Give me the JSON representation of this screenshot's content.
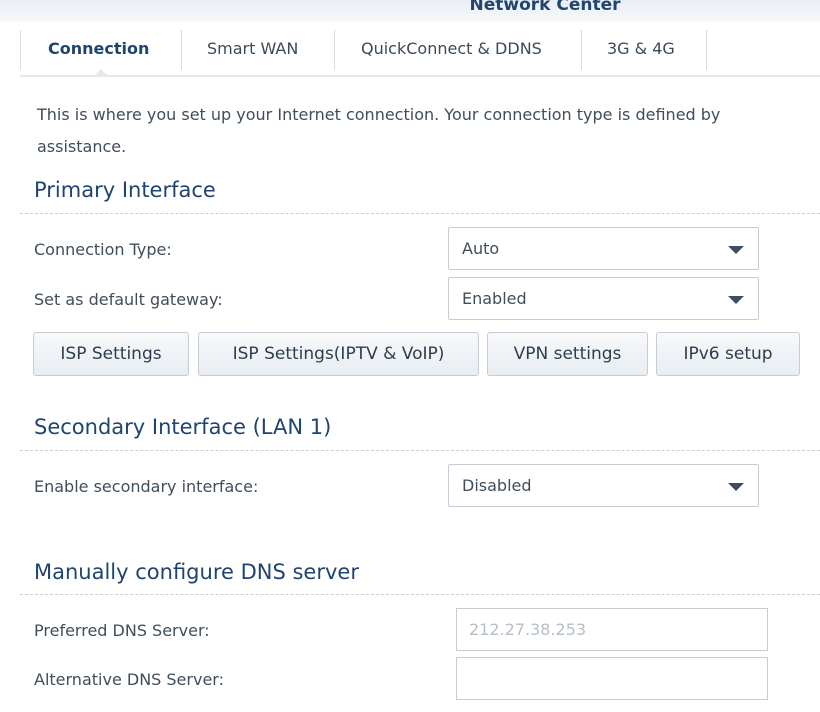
{
  "window": {
    "title": "Network Center"
  },
  "tabs": [
    {
      "label": "Connection",
      "active": true
    },
    {
      "label": "Smart WAN",
      "active": false
    },
    {
      "label": "QuickConnect & DDNS",
      "active": false
    },
    {
      "label": "3G & 4G",
      "active": false
    }
  ],
  "description": {
    "line1": "This is where you set up your Internet connection. Your connection type is defined by",
    "line2": "assistance."
  },
  "primary": {
    "title": "Primary Interface",
    "connection_type": {
      "label": "Connection Type:",
      "value": "Auto"
    },
    "default_gateway": {
      "label": "Set as default gateway:",
      "value": "Enabled"
    },
    "buttons": {
      "isp_settings": "ISP Settings",
      "isp_iptv": "ISP Settings(IPTV & VoIP)",
      "vpn": "VPN settings",
      "ipv6": "IPv6 setup"
    }
  },
  "secondary": {
    "title": "Secondary Interface (LAN 1)",
    "enable": {
      "label": "Enable secondary interface:",
      "value": "Disabled"
    }
  },
  "dns": {
    "title": "Manually configure DNS server",
    "preferred": {
      "label": "Preferred DNS Server:",
      "placeholder": "212.27.38.253",
      "value": ""
    },
    "alternative": {
      "label": "Alternative DNS Server:",
      "placeholder": "",
      "value": ""
    }
  },
  "colors": {
    "accent": "#1f4470",
    "text": "#404d5b",
    "border": "#c5ccd3"
  },
  "icons": {
    "select_caret": "caret-down-icon",
    "active_tab_pointer": "triangle-up-icon"
  }
}
